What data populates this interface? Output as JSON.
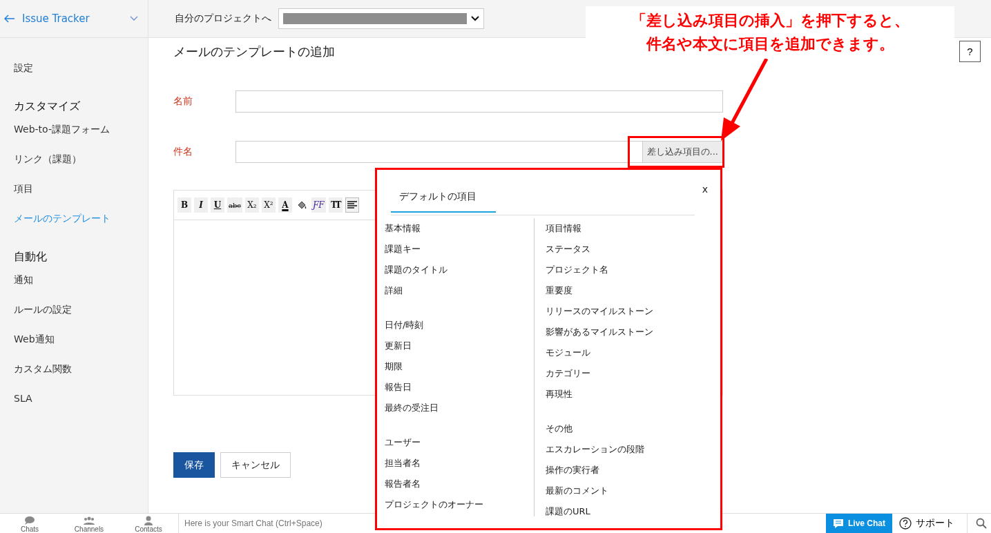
{
  "sidebar": {
    "app_name": "Issue Tracker",
    "items": [
      {
        "kind": "item",
        "label": "設定",
        "selected": false
      },
      {
        "kind": "heading",
        "label": "カスタマイズ"
      },
      {
        "kind": "item",
        "label": "Web-to-課題フォーム",
        "selected": false
      },
      {
        "kind": "item",
        "label": "リンク（課題）",
        "selected": false
      },
      {
        "kind": "item",
        "label": "項目",
        "selected": false
      },
      {
        "kind": "item",
        "label": "メールのテンプレート",
        "selected": true
      },
      {
        "kind": "heading",
        "label": "自動化"
      },
      {
        "kind": "item",
        "label": "通知",
        "selected": false
      },
      {
        "kind": "item",
        "label": "ルールの設定",
        "selected": false
      },
      {
        "kind": "item",
        "label": "Web通知",
        "selected": false
      },
      {
        "kind": "item",
        "label": "カスタム関数",
        "selected": false
      },
      {
        "kind": "item",
        "label": "SLA",
        "selected": false
      }
    ]
  },
  "top_bar": {
    "project_label": "自分のプロジェクトへ"
  },
  "page_title": "メールのテンプレートの追加",
  "help_button": "?",
  "form": {
    "name_label": "名前",
    "subject_label": "件名",
    "insert_button": "差し込み項目の...",
    "toolbar": [
      {
        "kind": "text",
        "label": "B"
      },
      {
        "kind": "text",
        "label": "I"
      },
      {
        "kind": "text",
        "label": "U"
      },
      {
        "kind": "text",
        "label": "abc"
      },
      {
        "kind": "text",
        "label": "X₂"
      },
      {
        "kind": "text",
        "label": "X²"
      },
      {
        "kind": "text",
        "label": "A"
      },
      {
        "kind": "fill"
      },
      {
        "kind": "text",
        "label": "ƑF"
      },
      {
        "kind": "text",
        "label": "TT"
      },
      {
        "kind": "align",
        "selected": true
      }
    ],
    "save": "保存",
    "cancel": "キャンセル"
  },
  "insert_menu": {
    "tab": "デフォルトの項目",
    "close": "x",
    "columns": [
      [
        {
          "heading": "基本情報",
          "items": [
            "課題キー",
            "課題のタイトル",
            "詳細"
          ]
        },
        {
          "heading": "日付/時刻",
          "items": [
            "更新日",
            "期限",
            "報告日",
            "最終の受注日"
          ]
        },
        {
          "heading": "ユーザー",
          "items": [
            "担当者名",
            "報告者名",
            "プロジェクトのオーナー"
          ]
        }
      ],
      [
        {
          "heading": "項目情報",
          "items": [
            "ステータス",
            "プロジェクト名",
            "重要度",
            "リリースのマイルストーン",
            "影響があるマイルストーン",
            "モジュール",
            "カテゴリー",
            "再現性"
          ]
        },
        {
          "heading": "その他",
          "items": [
            "エスカレーションの段階",
            "操作の実行者",
            "最新のコメント",
            "課題のURL"
          ]
        }
      ]
    ]
  },
  "bottom_bar": {
    "tabs": [
      "Chats",
      "Channels",
      "Contacts"
    ],
    "chat_placeholder": "Here is your Smart Chat (Ctrl+Space)",
    "live_chat": "Live Chat",
    "support": "サポート"
  },
  "annotation": {
    "lines": [
      "「差し込み項目の挿入」を押下すると、",
      "件名や本文に項目を追加できます。"
    ]
  }
}
